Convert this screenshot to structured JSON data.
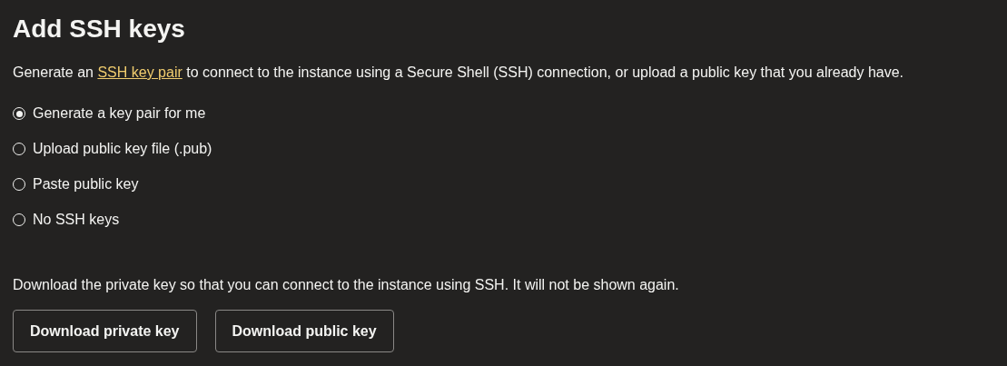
{
  "title": "Add SSH keys",
  "description": {
    "before": "Generate an ",
    "link": "SSH key pair",
    "after": " to connect to the instance using a Secure Shell (SSH) connection, or upload a public key that you already have."
  },
  "options": [
    {
      "label": "Generate a key pair for me",
      "selected": true
    },
    {
      "label": "Upload public key file (.pub)",
      "selected": false
    },
    {
      "label": "Paste public key",
      "selected": false
    },
    {
      "label": "No SSH keys",
      "selected": false
    }
  ],
  "note": "Download the private key so that you can connect to the instance using SSH. It will not be shown again.",
  "buttons": [
    "Download private key",
    "Download public key"
  ]
}
